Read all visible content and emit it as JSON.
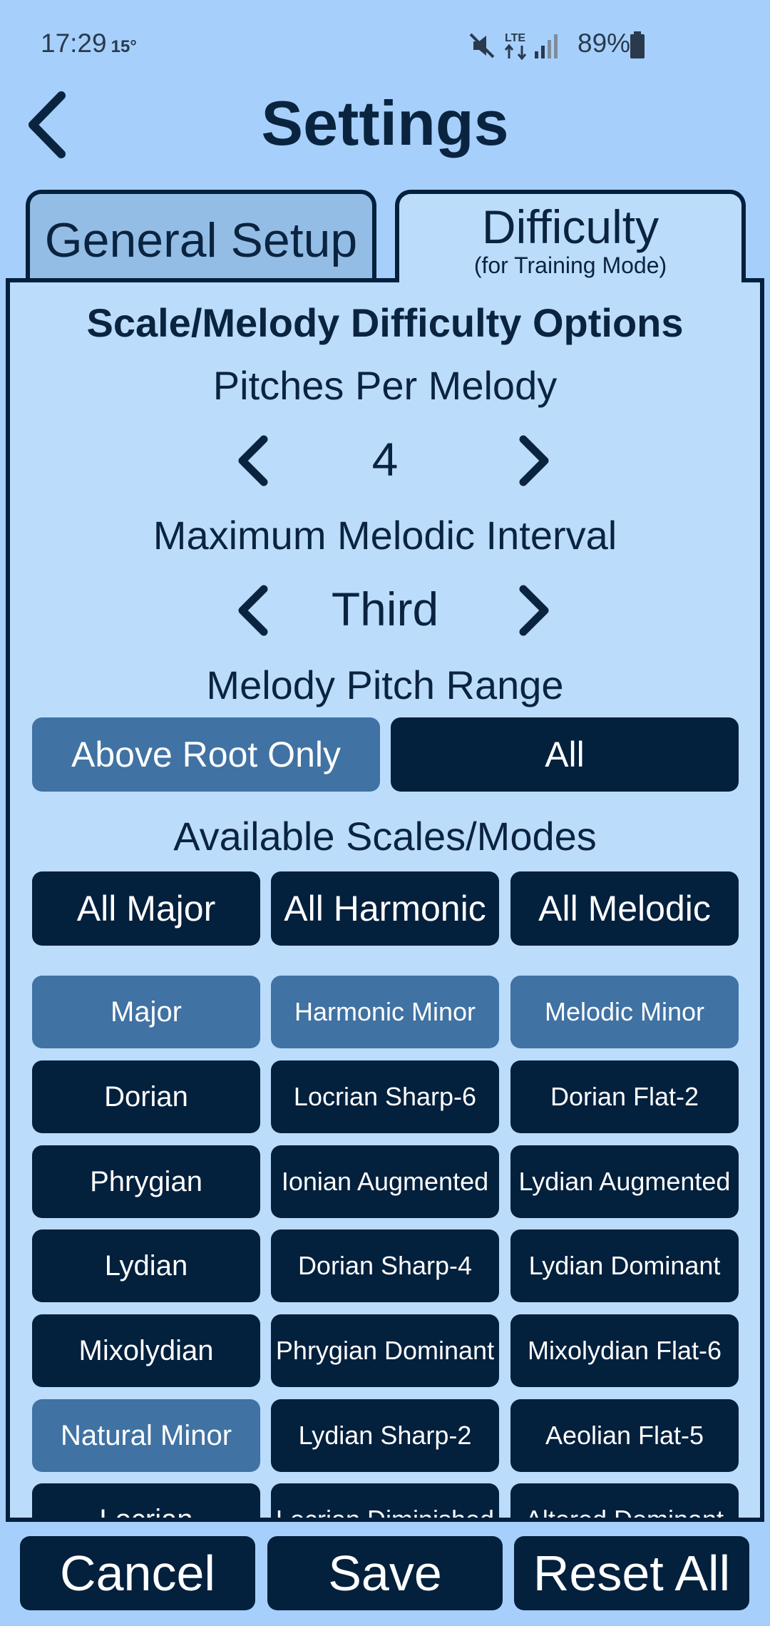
{
  "status_bar": {
    "time": "17:29",
    "temperature": "15°",
    "battery": "89%"
  },
  "header": {
    "title": "Settings"
  },
  "tabs": {
    "general": {
      "label": "General Setup"
    },
    "difficulty": {
      "label": "Difficulty",
      "sublabel": "(for Training Mode)"
    }
  },
  "panel": {
    "heading": "Scale/Melody Difficulty Options",
    "pitches": {
      "label": "Pitches Per Melody",
      "value": "4"
    },
    "interval": {
      "label": "Maximum Melodic Interval",
      "value": "Third"
    },
    "range": {
      "label": "Melody Pitch Range",
      "options": [
        "Above Root Only",
        "All"
      ],
      "selected": "Above Root Only"
    },
    "scales": {
      "label": "Available Scales/Modes",
      "group_buttons": [
        "All Major",
        "All Harmonic",
        "All Melodic"
      ],
      "rows": [
        [
          "Major",
          "Harmonic Minor",
          "Melodic Minor"
        ],
        [
          "Dorian",
          "Locrian Sharp-6",
          "Dorian Flat-2"
        ],
        [
          "Phrygian",
          "Ionian Augmented",
          "Lydian Augmented"
        ],
        [
          "Lydian",
          "Dorian Sharp-4",
          "Lydian Dominant"
        ],
        [
          "Mixolydian",
          "Phrygian Dominant",
          "Mixolydian Flat-6"
        ],
        [
          "Natural Minor",
          "Lydian Sharp-2",
          "Aeolian Flat-5"
        ],
        [
          "Locrian",
          "Locrian Diminished",
          "Altered Dominant"
        ]
      ],
      "selected": [
        "Major",
        "Harmonic Minor",
        "Melodic Minor",
        "Natural Minor"
      ]
    }
  },
  "footer": {
    "cancel": "Cancel",
    "save": "Save",
    "reset": "Reset All"
  },
  "colors": {
    "background": "#a6d0fb",
    "panel": "#bcdcfc",
    "dark": "#03203d",
    "selected": "#4072a3"
  }
}
